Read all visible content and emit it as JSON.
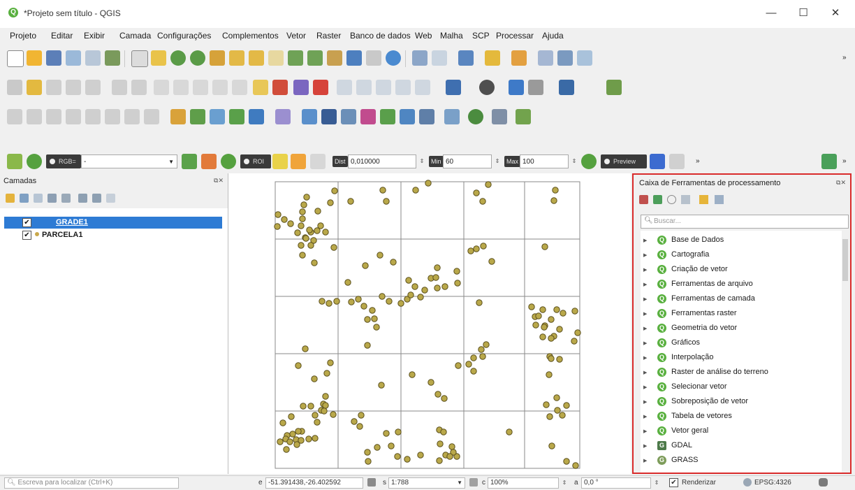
{
  "window": {
    "title": "*Projeto sem título - QGIS",
    "logo": "Q",
    "min": "—",
    "max": "☐",
    "close": "✕"
  },
  "menu": [
    "Projeto",
    "Editar",
    "Exibir",
    "Camada",
    "Configurações",
    "Complementos",
    "Vetor",
    "Raster",
    "Banco de dados",
    "Web",
    "Malha",
    "SCP",
    "Processar",
    "Ajuda"
  ],
  "toolbar_scp": {
    "rgb_label": "RGB=",
    "rgb_value": "-",
    "roi_label": "ROI",
    "dist_label": "Dist",
    "dist_value": "0,010000",
    "min_label": "Min",
    "min_value": "60",
    "max_label": "Max",
    "max_value": "100",
    "preview_label": "Preview",
    "more": "»"
  },
  "layers_panel": {
    "title": "Camadas",
    "layers": [
      {
        "name": "GRADE1",
        "checked": "✔",
        "selected": true
      },
      {
        "name": "PARCELA1",
        "checked": "✔",
        "selected": false
      }
    ]
  },
  "processing_panel": {
    "title": "Caixa de Ferramentas de processamento",
    "search_placeholder": "Buscar...",
    "items": [
      "Base de Dados",
      "Cartografia",
      "Criação de vetor",
      "Ferramentas de arquivo",
      "Ferramentas de camada",
      "Ferramentas raster",
      "Geometria do vetor",
      "Gráficos",
      "Interpolação",
      "Raster de análise do terreno",
      "Selecionar vetor",
      "Sobreposição de vetor",
      "Tabela de vetores",
      "Vetor geral",
      "GDAL",
      "GRASS"
    ]
  },
  "statusbar": {
    "locate_placeholder": "Escreva para localizar (Ctrl+K)",
    "coord_label": "e",
    "coordinate": "-51.391438,-26.402592",
    "scale_label": "s",
    "scale": "1:788",
    "magnifier_label": "c",
    "magnifier": "100%",
    "rotation_label": "a",
    "rotation": "0,0 °",
    "render_label": "Renderizar",
    "crs": "EPSG:4326"
  },
  "colors": {
    "accent": "#2e7bd4",
    "point_fill": "#b9a84a",
    "point_stroke": "#5a4f1c",
    "highlight_border": "#d92b2b",
    "qgis_green": "#59b03f"
  }
}
